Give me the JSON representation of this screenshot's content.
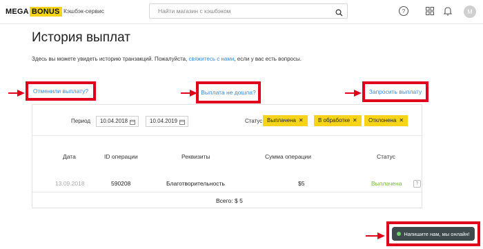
{
  "header": {
    "logo_mega": "MEGA",
    "logo_bonus": "BONUS",
    "logo_subtitle": "Кэшбэк-сервис",
    "search_placeholder": "Найти магазин с кэшбэком",
    "icons": [
      "help-circle-icon",
      "grid-icon",
      "bell-icon"
    ],
    "avatar_letter": "M"
  },
  "page": {
    "title": "История выплат",
    "intro_before": "Здесь вы можете увидеть историю транзакций. Пожалуйста, ",
    "intro_link": "свяжитесь с нами",
    "intro_after": ", если у вас есть вопросы."
  },
  "actions": {
    "cancel_payout": "Отменили выплату?",
    "payout_not_received": "Выплата не дошла?",
    "request_payout": "Запросить выплату"
  },
  "filters": {
    "period_label": "Период",
    "date_from": "10.04.2018",
    "date_to": "10.04.2019",
    "status_label": "Статус",
    "status_chips": [
      "Выплачена",
      "В обработке",
      "Отклонена"
    ]
  },
  "table": {
    "columns": [
      "Дата",
      "ID операции",
      "Реквизиты",
      "Сумма операции",
      "Статус"
    ],
    "rows": [
      {
        "date": "13.09.2018",
        "id": "590208",
        "details": "Благотворительность",
        "amount": "$5",
        "status": "Выплачена"
      }
    ],
    "total": "Всего: $ 5"
  },
  "chat": {
    "label": "Напишите нам, мы онлайн!"
  },
  "colors": {
    "accent_yellow": "#f7d417",
    "link_blue": "#3a8ad4",
    "status_green": "#7cba3e",
    "highlight_red": "#e0001b",
    "chat_bg": "#3e4a4c"
  }
}
